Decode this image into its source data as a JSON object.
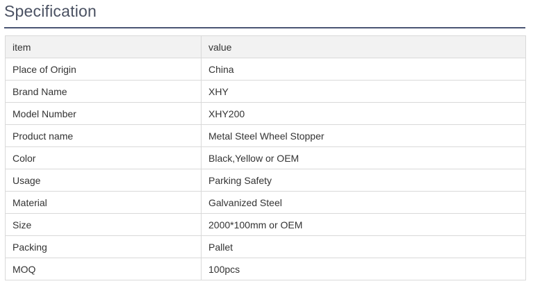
{
  "section": {
    "title": "Specification"
  },
  "table": {
    "header": [
      "item",
      "value"
    ],
    "rows": [
      [
        "Place of Origin",
        "China"
      ],
      [
        "Brand Name",
        "XHY"
      ],
      [
        "Model Number",
        "XHY200"
      ],
      [
        "Product name",
        "Metal Steel Wheel Stopper"
      ],
      [
        "Color",
        "Black,Yellow or OEM"
      ],
      [
        "Usage",
        "Parking Safety"
      ],
      [
        "Material",
        "Galvanized Steel"
      ],
      [
        "Size",
        "2000*100mm or OEM"
      ],
      [
        "Packing",
        "Pallet"
      ],
      [
        "MOQ",
        "100pcs"
      ]
    ]
  },
  "colors": {
    "title": "#4a5162",
    "rule": "#4a5573",
    "header_bg": "#f2f2f2",
    "border": "#d9d9d9"
  }
}
